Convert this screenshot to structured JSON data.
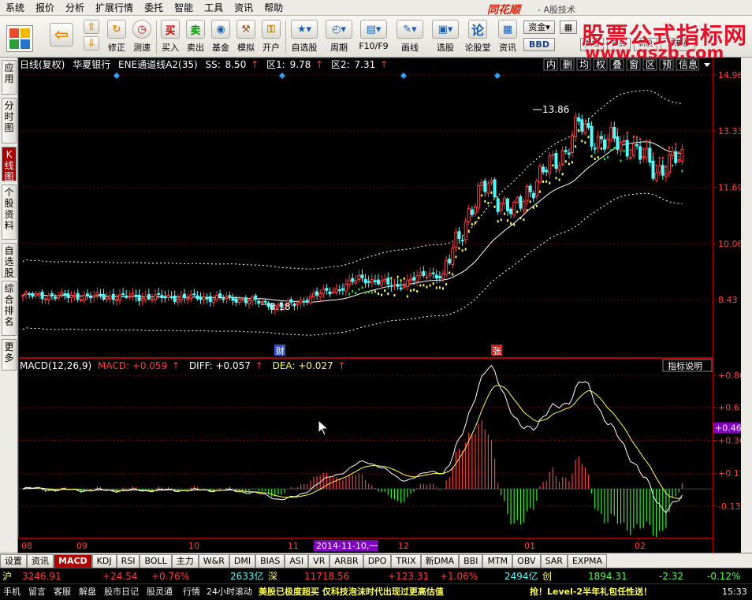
{
  "menu": [
    "系统",
    "报价",
    "分析",
    "扩展行情",
    "委托",
    "智能",
    "工具",
    "资讯",
    "帮助"
  ],
  "brand": "同花顺",
  "brand_sub": "- A股技术",
  "watermark": {
    "title": "股票公式指标网",
    "url": "www.gszb.com"
  },
  "toolbar": {
    "items": [
      "修正",
      "测速",
      "买入",
      "卖出",
      "基金",
      "模拟",
      "开户",
      "自选股",
      "周期",
      "F10/F9",
      "画线",
      "选股",
      "论股堂",
      "资讯"
    ],
    "fund_label": "资金",
    "bbd_label": "BBD",
    "hot_items": [
      "数据",
      "热点",
      "新股",
      "沪港通"
    ]
  },
  "left_tabs": [
    "应用",
    "分时图",
    "K线图",
    "个股资料",
    "自选股",
    "综合排名",
    "更多"
  ],
  "chart": {
    "header": {
      "period": "日线(复权)",
      "name": "华夏银行",
      "indicator": "ENE通道线A2(35)",
      "ss_label": "SS:",
      "ss": "8.50",
      "q1_label": "区1:",
      "q1": "9.78",
      "q2_label": "区2:",
      "q2": "7.31"
    },
    "right_buttons": [
      "内",
      "删",
      "均",
      "权",
      "叠",
      "窗",
      "区",
      "预",
      "信息"
    ],
    "price_axis": [
      "14.96",
      "13.33",
      "11.69",
      "10.06",
      "8.43"
    ],
    "high_label": "13.86",
    "low_label": "8.18",
    "events": [
      {
        "text": "财"
      },
      {
        "text": "张"
      }
    ],
    "macd_header": {
      "label": "MACD(12,26,9)",
      "macd": "MACD: +0.059",
      "diff": "DIFF: +0.057",
      "dea": "DEA: +0.027"
    },
    "indicator_help": "指标说明",
    "macd_axis": [
      "+0.863",
      "+0.619",
      "+0.369",
      "+0.119",
      "-0.131"
    ],
    "macd_highlight": "+0.464",
    "months": [
      "08",
      "09",
      "10",
      "11",
      "12",
      "01",
      "02"
    ],
    "date_highlight": "2014-11-10,一"
  },
  "colors": {
    "up": "#ff3c3c",
    "down": "#54fcfc",
    "axis": "#b00000",
    "yellow": "#ffff54",
    "white": "#ffffff",
    "green": "#33dd33",
    "purple": "#8000c0"
  },
  "tabs": [
    "设置",
    "资讯",
    "MACD",
    "KDJ",
    "RSI",
    "BOLL",
    "主力",
    "W&R",
    "DMI",
    "BIAS",
    "ASI",
    "VR",
    "ARBR",
    "DPO",
    "TRIX",
    "新DMA",
    "BBI",
    "MTM",
    "OBV",
    "SAR",
    "EXPMA"
  ],
  "ticker": {
    "sh_label": "沪",
    "sh_index": "3246.91",
    "sh_change": "+24.54",
    "sh_pct": "+0.76%",
    "sh_amount": "2633亿",
    "sz_label": "深",
    "sz_index": "11718.56",
    "sz_change": "+123.31",
    "sz_pct": "+1.06%",
    "sz_amount": "2494亿",
    "cy_label": "创",
    "cy_index": "1894.31",
    "cy_change": "-2.32",
    "cy_pct": "-0.12%"
  },
  "status": {
    "items": [
      "手机",
      "留言",
      "客服",
      "解盘",
      "股市日记",
      "股灵通",
      "行情",
      "24小时滚动"
    ],
    "news": "美股已极度超买 仅科技泡沫时代出现过更高估值",
    "promo": "抢！Level-2半年礼包任性送！",
    "time": "15:33"
  }
}
